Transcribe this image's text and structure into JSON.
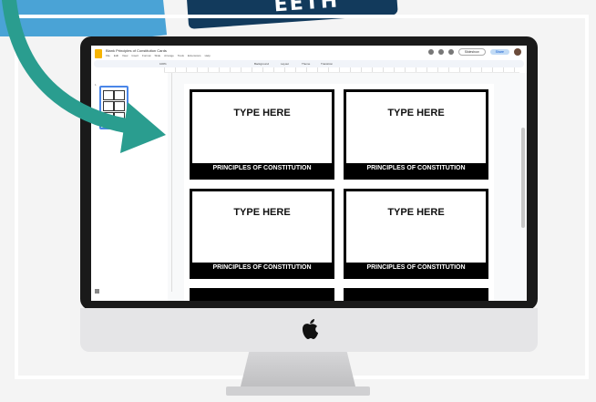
{
  "banner": {
    "text": "EETH"
  },
  "app": {
    "document_title": "Blank Principles of Constitution Cards",
    "menu": [
      "File",
      "Edit",
      "View",
      "Insert",
      "Format",
      "Slide",
      "Arrange",
      "Tools",
      "Extensions",
      "Help"
    ],
    "slideshow_label": "Slideshow",
    "share_label": "Share",
    "zoom": "100%",
    "toolbar": {
      "background": "Background",
      "layout": "Layout",
      "theme": "Theme",
      "transition": "Transition"
    },
    "filmstrip": {
      "slide_number": "1"
    }
  },
  "slide": {
    "cards": [
      {
        "title": "TYPE HERE",
        "footer": "PRINCIPLES OF CONSTITUTION"
      },
      {
        "title": "TYPE HERE",
        "footer": "PRINCIPLES OF CONSTITUTION"
      },
      {
        "title": "TYPE HERE",
        "footer": "PRINCIPLES OF CONSTITUTION"
      },
      {
        "title": "TYPE HERE",
        "footer": "PRINCIPLES OF CONSTITUTION"
      }
    ]
  },
  "colors": {
    "arrow": "#2a9d8f",
    "accent_blue": "#4a86e8",
    "banner_blue": "#4aa3d6",
    "banner_dark": "#123a5c"
  },
  "icons": [
    "apple-logo-icon",
    "arrow-icon",
    "slides-logo-icon",
    "grid-view-icon"
  ]
}
